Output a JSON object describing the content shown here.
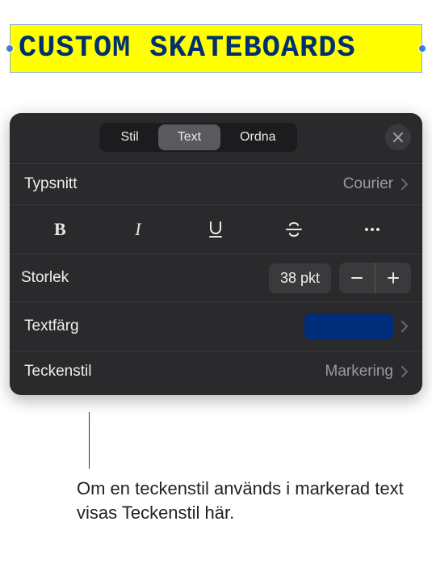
{
  "canvas": {
    "sample_text": "CUSTOM SKATEBOARDS"
  },
  "panel": {
    "tabs": {
      "style": "Stil",
      "text": "Text",
      "arrange": "Ordna"
    },
    "font": {
      "label": "Typsnitt",
      "value": "Courier"
    },
    "size": {
      "label": "Storlek",
      "value": "38 pkt"
    },
    "text_color": {
      "label": "Textfärg",
      "color": "#002d7a"
    },
    "character_style": {
      "label": "Teckenstil",
      "value": "Markering"
    }
  },
  "callout": {
    "text": "Om en teckenstil används i markerad text visas Teckenstil här."
  }
}
